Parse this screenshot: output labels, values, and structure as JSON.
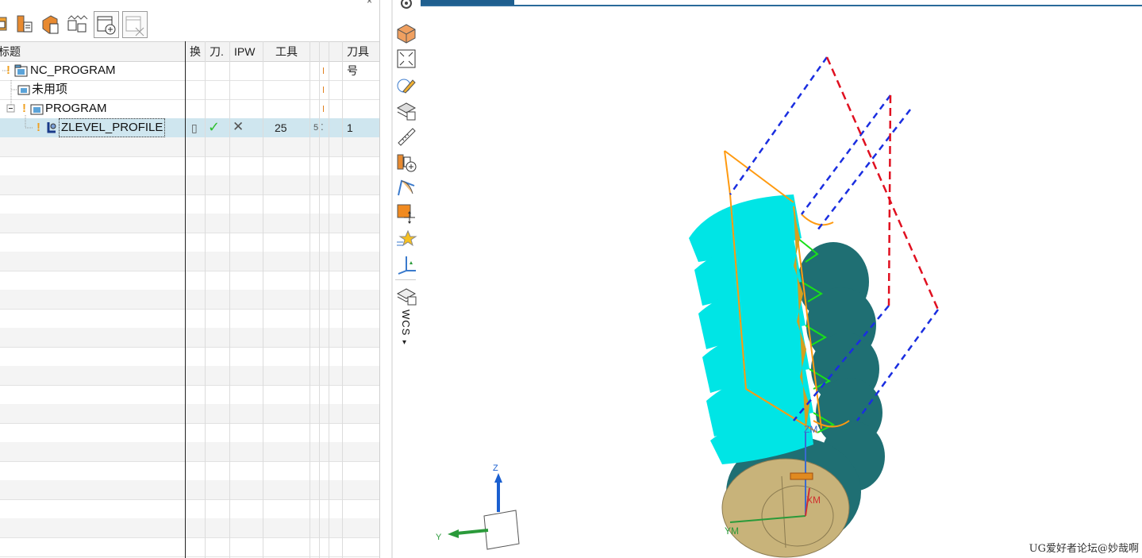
{
  "navigator": {
    "title": "",
    "close": "×",
    "columns": [
      {
        "key": "name",
        "label": "标题"
      },
      {
        "key": "change",
        "label": "换"
      },
      {
        "key": "path",
        "label": "刀."
      },
      {
        "key": "ipw",
        "label": "IPW"
      },
      {
        "key": "tool",
        "label": "工具"
      },
      {
        "key": "col6",
        "label": ""
      },
      {
        "key": "col7",
        "label": ""
      },
      {
        "key": "toolnum",
        "label": "刀具号"
      }
    ],
    "rows": [
      {
        "name": "NC_PROGRAM",
        "change": "",
        "path": "",
        "ipw": "",
        "tool": "",
        "col6": "",
        "toolnum": ""
      },
      {
        "name": "未用项",
        "change": "",
        "path": "",
        "ipw": "",
        "tool": "",
        "col6": "",
        "toolnum": ""
      },
      {
        "name": "PROGRAM",
        "change": "",
        "path": "",
        "ipw": "",
        "tool": "",
        "col6": "",
        "toolnum": ""
      },
      {
        "name": "ZLEVEL_PROFILE",
        "change": "▯",
        "path": "✓",
        "ipw": "✕",
        "tool": "25",
        "col6": "5 ⁚",
        "toolnum": "1"
      }
    ]
  },
  "toolbar_icons": [
    "program-view-icon",
    "machine-tool-view-icon",
    "geometry-view-icon",
    "method-view-icon",
    "create-program-icon",
    "delete-icon"
  ],
  "vertical_toolbar": {
    "icons": [
      "settings-icon",
      "display-part-icon",
      "fit-view-icon",
      "sketch-icon",
      "layer-icon",
      "measure-icon",
      "assembly-icon",
      "section-icon",
      "move-icon",
      "highlight-icon",
      "wcs-orient-icon",
      "layer-settings-icon"
    ],
    "wcs_label": "WCS",
    "wcs_caret": "▾"
  },
  "graphics": {
    "triad": {
      "z": "Z",
      "y": "Y"
    },
    "work_coords": {
      "zm": "ZM",
      "ym": "YM",
      "xm": "XM"
    },
    "colors": {
      "tool_path": "#00e5e5",
      "part": "#1f6f73",
      "stock_face": "#c8b37a",
      "cut_region": "#ff9a10",
      "safe_plane": "#1a2ee0",
      "clearance": "#e01020",
      "engage": "#19e019"
    }
  },
  "watermark": "UG爱好者论坛@妙哉啊"
}
